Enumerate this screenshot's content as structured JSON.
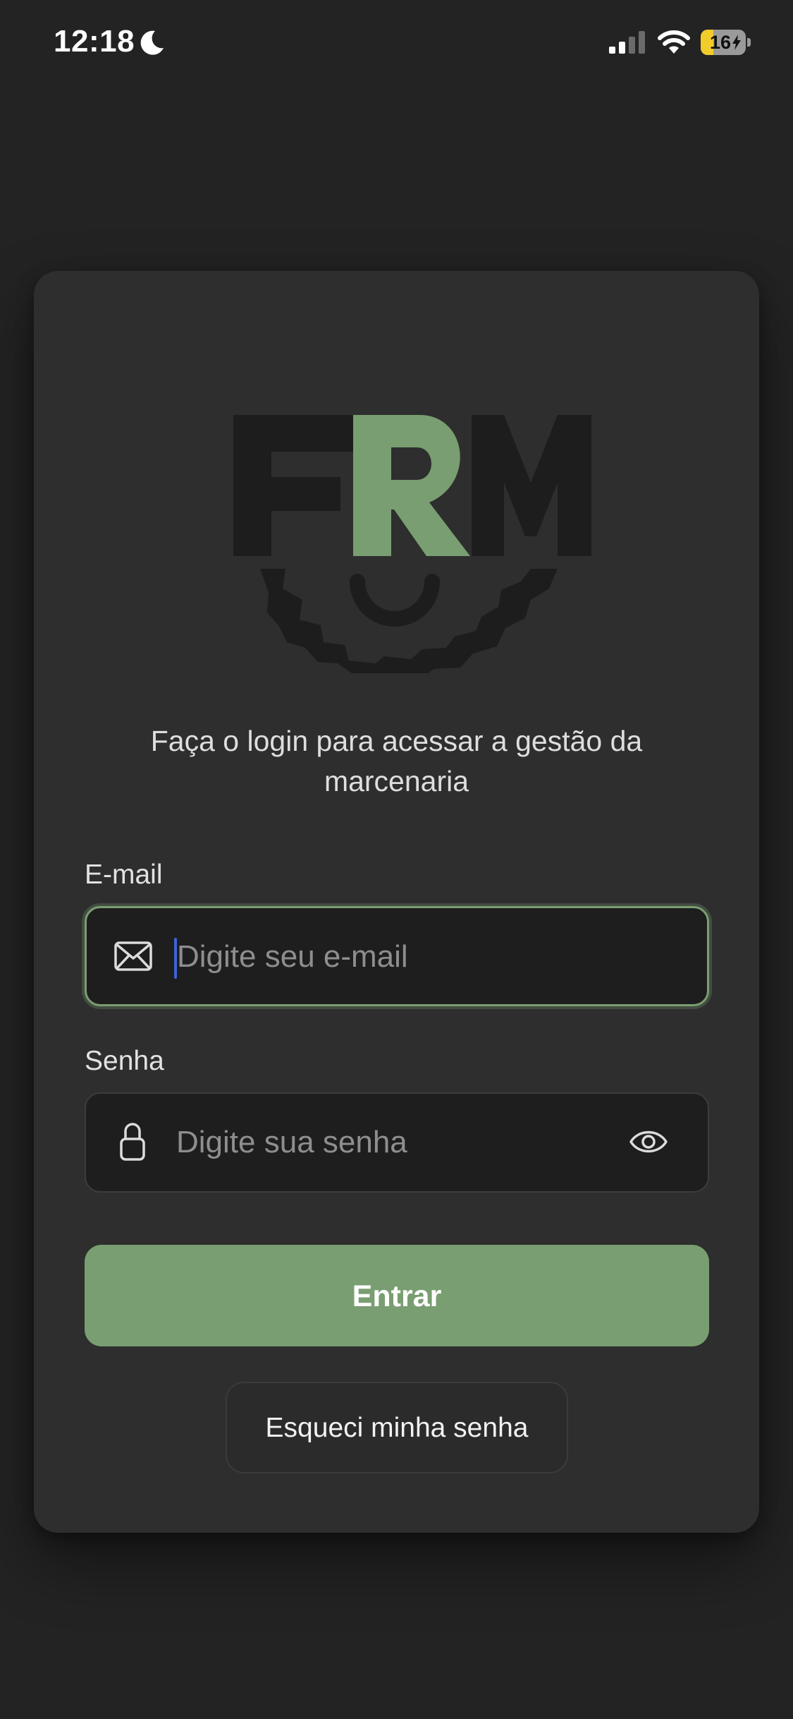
{
  "status_bar": {
    "time": "12:18",
    "focus_mode_icon": "moon-icon",
    "signal_icon": "cellular-signal-icon",
    "wifi_icon": "wifi-icon",
    "battery_level": "16",
    "battery_fraction": 0.16,
    "battery_charging": true
  },
  "logo": {
    "text": "FRM",
    "colors": {
      "dark": "#1d1d1d",
      "accent": "#799e71"
    }
  },
  "login": {
    "subtitle": "Faça o login para acessar a gestão da marcenaria",
    "email": {
      "label": "E-mail",
      "placeholder": "Digite seu e-mail",
      "value": "",
      "icon": "envelope-icon",
      "focused": true
    },
    "password": {
      "label": "Senha",
      "placeholder": "Digite sua senha",
      "value": "",
      "icon": "lock-icon",
      "toggle_icon": "eye-icon"
    },
    "submit_label": "Entrar",
    "forgot_label": "Esqueci minha senha"
  },
  "colors": {
    "background": "#232323",
    "card": "#2e2e2e",
    "accent": "#799e71",
    "input_background": "#1e1e1e",
    "caret": "#3f63d8"
  }
}
